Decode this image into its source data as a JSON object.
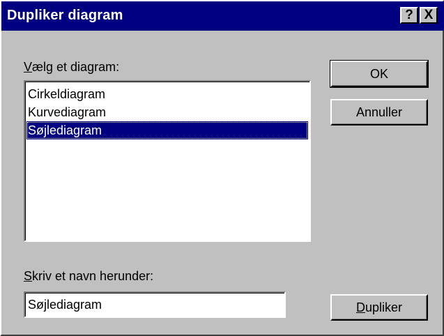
{
  "window": {
    "title": "Dupliker diagram",
    "help_label": "?",
    "close_label": "X"
  },
  "list_section": {
    "label_accel": "V",
    "label_rest": "ælg et diagram:",
    "items": [
      {
        "label": "Cirkeldiagram",
        "selected": false
      },
      {
        "label": "Kurvediagram",
        "selected": false
      },
      {
        "label": "Søjlediagram",
        "selected": true
      }
    ]
  },
  "name_section": {
    "label_accel": "S",
    "label_rest": "kriv et navn herunder:",
    "value": "Søjlediagram"
  },
  "buttons": {
    "ok_label": "OK",
    "cancel_label": "Annuller",
    "duplicate_accel": "D",
    "duplicate_rest": "upliker"
  },
  "colors": {
    "face": "#c0c0c0",
    "titlebar": "#000080",
    "selection": "#000080"
  }
}
